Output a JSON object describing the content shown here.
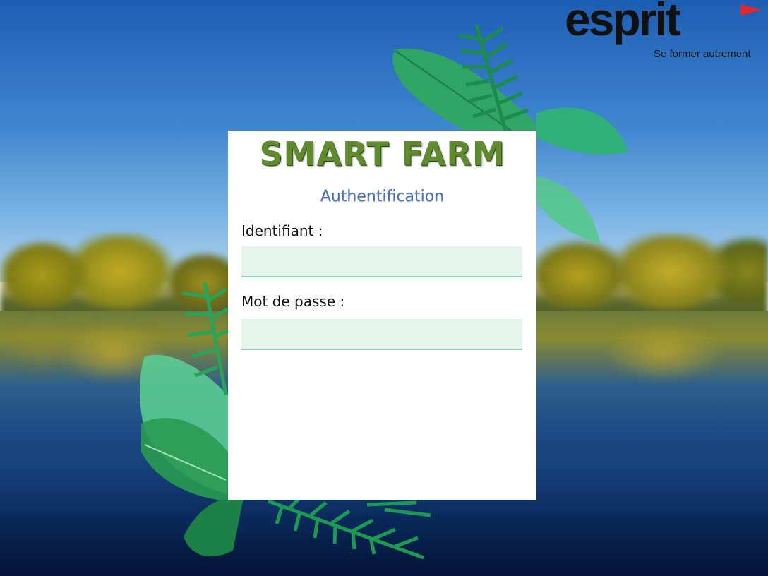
{
  "app": {
    "title": "SMART FARM",
    "subtitle": "Authentification"
  },
  "logo": {
    "name": "esprit",
    "tagline": "Se former autrement",
    "flag_color": "#e3262b"
  },
  "form": {
    "username_label": "Identifiant :",
    "username_value": "",
    "password_label": "Mot de passe :",
    "password_value": ""
  },
  "colors": {
    "title": "#5f8a2e",
    "subtitle": "#4a73b5",
    "field_bg": "#e5f4ec",
    "field_border": "#96d0ad"
  },
  "icons": [
    "leaf-decoration-icon",
    "palm-leaf-icon",
    "monstera-leaf-icon"
  ]
}
